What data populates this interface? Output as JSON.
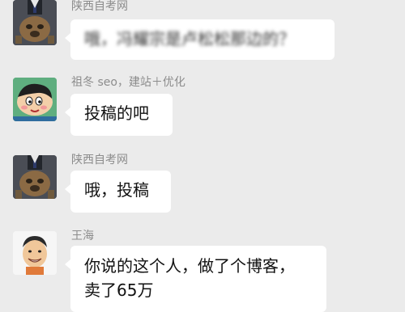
{
  "messages": [
    {
      "sender": "陕西自考网",
      "avatar": "avatar-shaanxi-zikao",
      "text": "哦，冯耀宗是卢松松那边的？"
    },
    {
      "sender": "祖冬 seo，建站＋优化",
      "avatar": "avatar-cartoon-boy",
      "text": "投稿的吧"
    },
    {
      "sender": "陕西自考网",
      "avatar": "avatar-shaanxi-zikao",
      "text": "哦，投稿"
    },
    {
      "sender": "王海",
      "avatar": "avatar-cartoon-man",
      "text_line1": "你说的这个人，做了个博客，",
      "text_line2": "卖了65万"
    }
  ],
  "colors": {
    "background": "#ebebeb",
    "bubble": "#ffffff",
    "sender_text": "#8c8c8c",
    "message_text": "#111111"
  }
}
